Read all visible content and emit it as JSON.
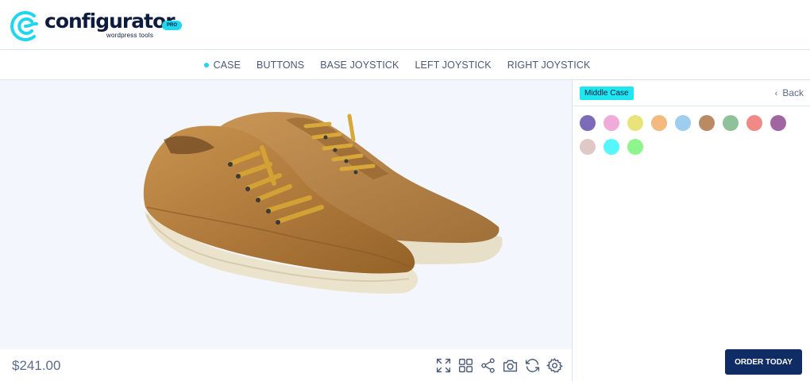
{
  "brand": {
    "name": "configurator",
    "subtitle": "wordpress tools",
    "badge": "PRO",
    "accent": "#1fd6ef",
    "navy": "#0d1b3e"
  },
  "nav": {
    "tabs": [
      {
        "label": "CASE",
        "active": true
      },
      {
        "label": "BUTTONS",
        "active": false
      },
      {
        "label": "BASE JOYSTICK",
        "active": false
      },
      {
        "label": "LEFT JOYSTICK",
        "active": false
      },
      {
        "label": "RIGHT JOYSTICK",
        "active": false
      }
    ]
  },
  "viewer": {
    "product_image": "brown-canvas-sneakers",
    "background": "#f3f7fd"
  },
  "footer": {
    "price": "$241.00",
    "tools": [
      "fullscreen-icon",
      "grid-icon",
      "share-icon",
      "camera-icon",
      "refresh-icon",
      "settings-icon"
    ]
  },
  "panel": {
    "title": "Middle Case",
    "back_label": "Back",
    "swatches": [
      "#7b6bb8",
      "#f0abda",
      "#e8e47a",
      "#f4b97e",
      "#9fcdf0",
      "#b98a63",
      "#8fc29b",
      "#f08a87",
      "#a066a2",
      "#e0c8c6",
      "#56f6fb",
      "#8cf58c"
    ]
  },
  "order_button": {
    "label": "ORDER TODAY",
    "color": "#102c64"
  }
}
